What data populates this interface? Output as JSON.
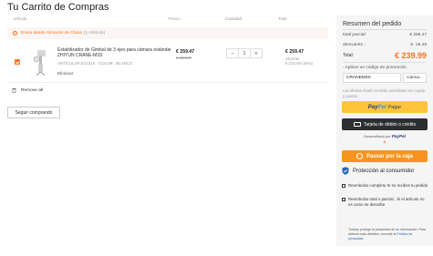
{
  "page": {
    "title": "Tu Carrito de Compras"
  },
  "cart": {
    "headers": {
      "article": "Artículo",
      "price": "Precio",
      "quantity": "Cantidad",
      "total": "Total"
    },
    "shipping": {
      "label": "Envía desde Almacén de China",
      "count": "(1 Artículo)"
    },
    "item": {
      "title": "Estabilizador de Gimbal de 3 ejes para cámara estándar ZHIYUN CRANE-M3S",
      "meta": "ARTÍCULO#:D12315 · COLOR : BLANCO",
      "delete_label": "Eliminar",
      "price": "€ 259.47",
      "old_price": "€ 484.07",
      "quantity": "1",
      "qty_minus": "−",
      "qty_plus": "+",
      "total": "€ 259.47",
      "save_label": "Ahorras",
      "save_value": "€ 224.60 (46%)"
    },
    "remove_all": "Remove all",
    "continue_label": "Seguir comprando"
  },
  "summary": {
    "title": "Resumen del pedido",
    "subtotal_label": "total parcial:",
    "subtotal_value": "€ 259.47",
    "discount_label": "descuento :",
    "discount_value": "€ -19.48",
    "total_label": "Total:",
    "total_value": "€  239.99",
    "promo_label": "- Aplicar un código de promoción",
    "promo_value": "CRANEM3S",
    "promo_button": "Canca...",
    "flash_note": "Las ofertas Flash no están permitidas con cupón y puntos",
    "paypal_pay": "Pagar",
    "paypal_word1": "Pay",
    "paypal_word2": "Pal",
    "card_label": "Tarjeta de débito o crédito",
    "powered_label": "Desarrollado por",
    "powered_brand": "PayPal",
    "plus": "+",
    "cash_label": "Pasear por la caja",
    "protect_title": "Protección al consumidor",
    "bullet1": "Reembolso completo Si no recibes tu pedido",
    "bullet2": "Reembolso total o parcial , Si el artículo no es como se describe",
    "fine_text": "Tomtop protege la privacidad de su información. Para obtener más detalles, consulte la",
    "fine_link": "Política de privacidad."
  },
  "colors": {
    "accent": "#f57224",
    "paypal_yellow": "#ffc439",
    "dark_button": "#2c2e2f",
    "cash_orange": "#f7941d"
  }
}
